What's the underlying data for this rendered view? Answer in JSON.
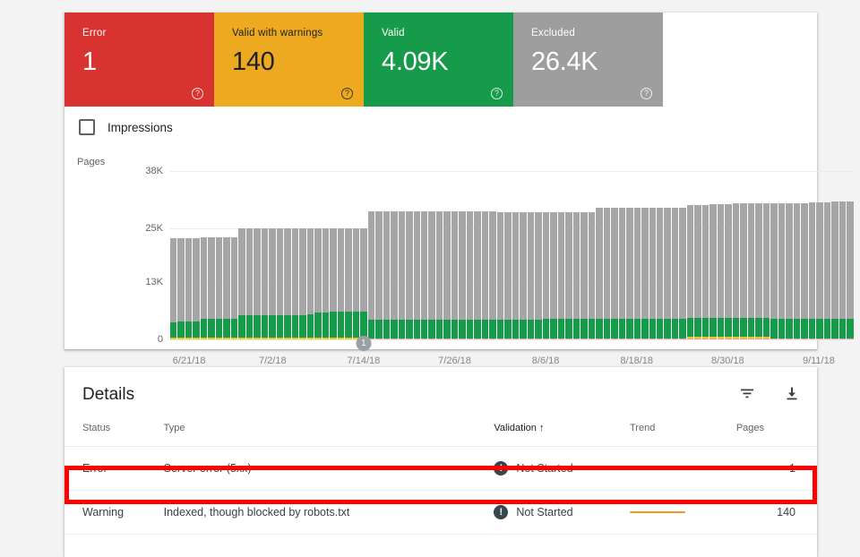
{
  "summary": {
    "tiles": [
      {
        "label": "Error",
        "value": "1",
        "color": "#d93331",
        "text_mode": "tile-light",
        "help": "?"
      },
      {
        "label": "Valid with warnings",
        "value": "140",
        "color": "#eda920",
        "text_mode": "tile-dark",
        "help": "?"
      },
      {
        "label": "Valid",
        "value": "4.09K",
        "color": "#169b4b",
        "text_mode": "tile-light",
        "help": "?"
      },
      {
        "label": "Excluded",
        "value": "26.4K",
        "color": "#9e9e9e",
        "text_mode": "tile-light",
        "help": "?"
      }
    ]
  },
  "chart_controls": {
    "impressions_label": "Impressions",
    "impressions_checked": false
  },
  "chart_data": {
    "type": "bar",
    "stacked": true,
    "title": "",
    "ylabel": "Pages",
    "xlabel": "",
    "ylim": [
      0,
      38000
    ],
    "yticks": [
      0,
      13000,
      25000,
      38000
    ],
    "ytick_labels": [
      "0",
      "13K",
      "25K",
      "38K"
    ],
    "grid": true,
    "legend_position": "none",
    "x_tick_labels": [
      "6/21/18",
      "7/2/18",
      "7/14/18",
      "7/26/18",
      "8/6/18",
      "8/18/18",
      "8/30/18",
      "9/11/18"
    ],
    "x_tick_indices": [
      2,
      13,
      25,
      37,
      49,
      61,
      73,
      85
    ],
    "annotations": [
      {
        "label": "1",
        "x_index": 25,
        "text": "7/14/18"
      }
    ],
    "series": [
      {
        "name": "Error",
        "color": "#e8a0a0",
        "values": [
          0,
          0,
          0,
          0,
          0,
          0,
          0,
          0,
          0,
          0,
          0,
          0,
          0,
          0,
          0,
          0,
          0,
          0,
          0,
          0,
          0,
          0,
          0,
          0,
          0,
          0,
          300,
          300,
          300,
          300,
          300,
          300,
          300,
          300,
          300,
          300,
          300,
          300,
          300,
          300,
          300,
          300,
          300,
          300,
          300,
          300,
          300,
          300,
          300,
          300,
          300,
          300,
          300,
          300,
          300,
          300,
          300,
          300,
          300,
          300,
          300,
          300,
          300,
          300,
          300,
          300,
          300,
          300,
          300,
          300,
          300,
          300,
          300,
          300,
          300,
          300,
          300,
          300,
          300,
          300,
          300,
          300,
          300,
          300,
          300,
          300,
          300,
          300,
          300,
          300
        ]
      },
      {
        "name": "Valid with warnings",
        "color": "#f0c419",
        "values": [
          350,
          350,
          350,
          350,
          350,
          350,
          350,
          350,
          350,
          350,
          350,
          350,
          350,
          350,
          350,
          350,
          350,
          350,
          350,
          350,
          350,
          350,
          350,
          350,
          350,
          350,
          0,
          0,
          0,
          0,
          0,
          0,
          0,
          0,
          0,
          0,
          0,
          0,
          0,
          0,
          0,
          0,
          0,
          0,
          0,
          0,
          0,
          0,
          0,
          0,
          0,
          0,
          0,
          0,
          0,
          0,
          0,
          0,
          0,
          0,
          0,
          0,
          0,
          0,
          0,
          0,
          0,
          0,
          300,
          300,
          300,
          300,
          300,
          300,
          300,
          300,
          300,
          300,
          300,
          0,
          0,
          0,
          0,
          0,
          0,
          0,
          0,
          0,
          0,
          0
        ]
      },
      {
        "name": "Valid",
        "color": "#169b4b",
        "values": [
          3400,
          3600,
          3600,
          3600,
          4300,
          4300,
          4300,
          4300,
          4300,
          5200,
          5200,
          5200,
          5200,
          5200,
          5200,
          5200,
          5200,
          5200,
          5400,
          5700,
          5700,
          5900,
          5900,
          5900,
          5900,
          5900,
          4100,
          4100,
          4100,
          4100,
          4100,
          4100,
          4100,
          4100,
          4100,
          4100,
          4100,
          4100,
          4100,
          4100,
          4100,
          4100,
          4100,
          4100,
          4100,
          4100,
          4100,
          4100,
          4100,
          4300,
          4300,
          4300,
          4300,
          4300,
          4300,
          4300,
          4300,
          4300,
          4300,
          4300,
          4300,
          4300,
          4300,
          4300,
          4300,
          4300,
          4300,
          4300,
          4300,
          4300,
          4300,
          4300,
          4300,
          4300,
          4300,
          4300,
          4300,
          4300,
          4300,
          4300,
          4300,
          4300,
          4300,
          4300,
          4300,
          4300,
          4300,
          4300,
          4300,
          4300
        ]
      },
      {
        "name": "Excluded",
        "color": "#a6a6a6",
        "values": [
          19000,
          18800,
          18800,
          18800,
          18500,
          18500,
          18500,
          18500,
          18500,
          19600,
          19600,
          19600,
          19600,
          19600,
          19600,
          19600,
          19600,
          19600,
          19400,
          19100,
          19100,
          18900,
          18900,
          18900,
          18900,
          18900,
          24500,
          24500,
          24500,
          24500,
          24500,
          24500,
          24500,
          24500,
          24500,
          24500,
          24500,
          24500,
          24500,
          24500,
          24500,
          24500,
          24500,
          24300,
          24300,
          24300,
          24300,
          24300,
          24300,
          24100,
          24100,
          24100,
          24100,
          24100,
          24100,
          24100,
          25200,
          25200,
          25200,
          25200,
          25200,
          25200,
          25200,
          25200,
          25200,
          25200,
          25200,
          25200,
          25400,
          25400,
          25400,
          25600,
          25600,
          25600,
          25900,
          25900,
          25900,
          25900,
          25900,
          26100,
          26100,
          26100,
          26200,
          26200,
          26400,
          26400,
          26400,
          26500,
          26500,
          26600
        ]
      }
    ]
  },
  "details": {
    "title": "Details",
    "filter_icon": "filter-icon",
    "download_icon": "download-icon",
    "columns": {
      "status": "Status",
      "type": "Type",
      "validation": "Validation",
      "validation_sort": "↑",
      "trend": "Trend",
      "pages": "Pages"
    },
    "rows": [
      {
        "status": "Error",
        "status_class": "st-error",
        "type": "Server error (5xx)",
        "validation": "Not Started",
        "validation_icon": "exclamation-icon",
        "trend_color": "#e05a52",
        "pages": "1",
        "highlighted": true
      },
      {
        "status": "Warning",
        "status_class": "st-warning",
        "type": "Indexed, though blocked by robots.txt",
        "validation": "Not Started",
        "validation_icon": "exclamation-icon",
        "trend_color": "#f0962b",
        "pages": "140",
        "highlighted": false
      }
    ]
  },
  "annotation_overlay": {
    "color": "#ff0000",
    "target": "error-row"
  }
}
